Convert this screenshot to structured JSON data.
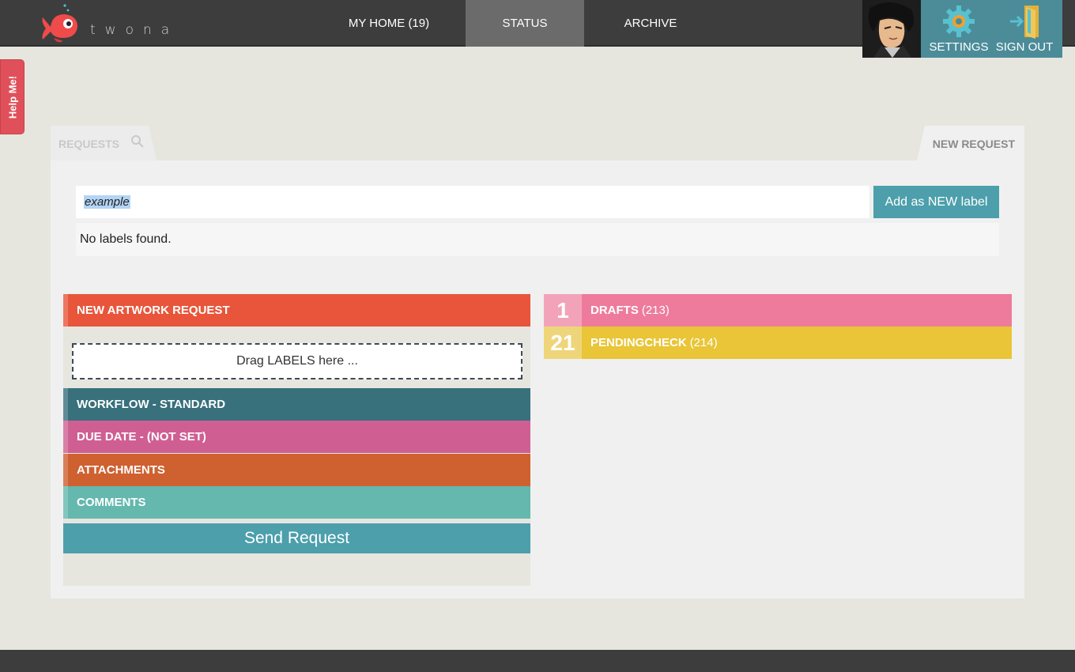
{
  "app": {
    "logo_text": "twona",
    "brand_color": "#f04b4b"
  },
  "nav": {
    "items": [
      {
        "label": "MY HOME (19)",
        "active": false
      },
      {
        "label": "STATUS",
        "active": true
      },
      {
        "label": "ARCHIVE",
        "active": false
      }
    ]
  },
  "user_panel": {
    "settings_label": "SETTINGS",
    "signout_label": "SIGN OUT"
  },
  "help": {
    "label": "Help Me!"
  },
  "tabs": {
    "requests_label": "REQUESTS",
    "new_request_label": "NEW REQUEST"
  },
  "label_search": {
    "value": "example",
    "add_button": "Add as NEW label",
    "empty_message": "No labels found."
  },
  "request_form": {
    "title": "NEW ARTWORK REQUEST",
    "drop_zone": "Drag LABELS here ...",
    "rows": [
      {
        "label": "WORKFLOW - STANDARD",
        "color": "#38707c"
      },
      {
        "label": "DUE DATE - (NOT SET)",
        "color": "#cf5f93"
      },
      {
        "label": "ATTACHMENTS",
        "color": "#cf6030"
      },
      {
        "label": "COMMENTS",
        "color": "#64b8ae"
      }
    ],
    "title_color": "#e8553a",
    "send_button": "Send Request"
  },
  "status_list": [
    {
      "count": "1",
      "name": "DRAFTS",
      "total": "(213)",
      "color": "#ee7b9b",
      "num_color": "#f2a3b9"
    },
    {
      "count": "21",
      "name": "PENDINGCHECK",
      "total": "(214)",
      "color": "#e9c537",
      "num_color": "#efd57a"
    }
  ]
}
